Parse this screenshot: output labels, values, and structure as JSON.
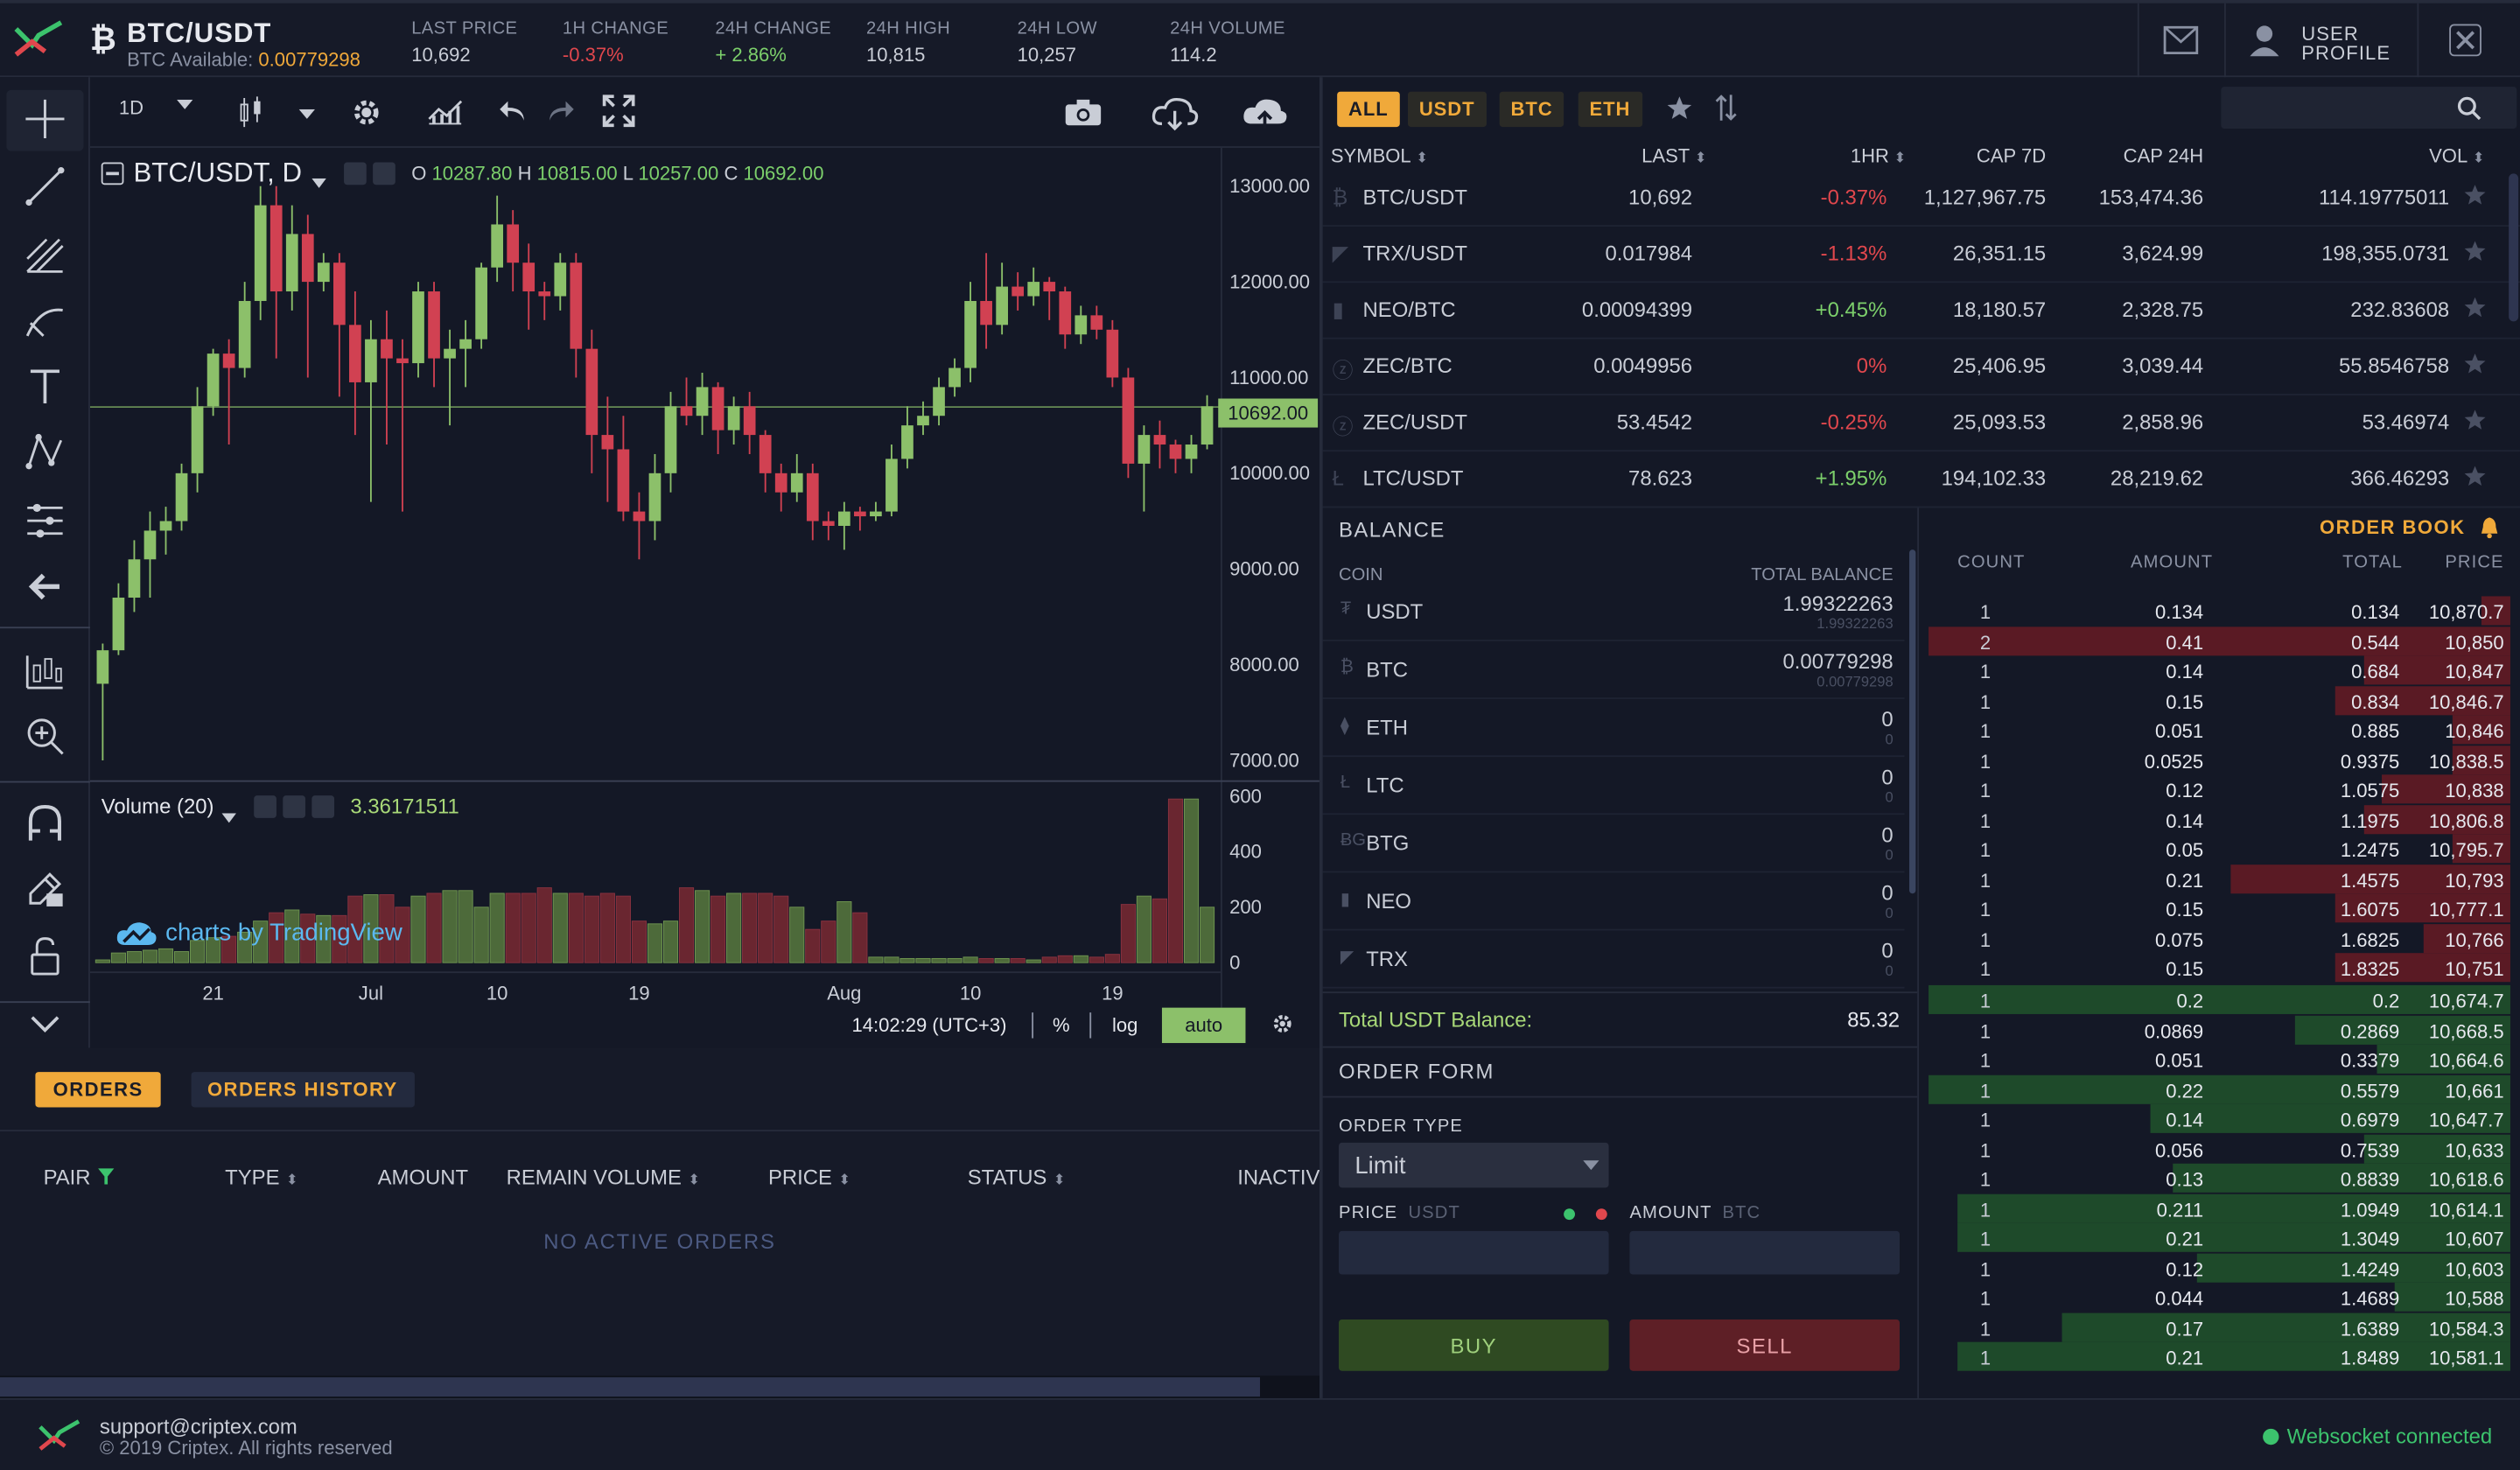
{
  "header": {
    "pair": "BTC/USDT",
    "available_label": "BTC Available:",
    "available_value": "0.00779298",
    "stats": [
      {
        "label": "LAST PRICE",
        "value": "10,692",
        "tone": "neutral"
      },
      {
        "label": "1H CHANGE",
        "value": "-0.37%",
        "tone": "red"
      },
      {
        "label": "24H CHANGE",
        "value": "+ 2.86%",
        "tone": "green"
      },
      {
        "label": "24H HIGH",
        "value": "10,815",
        "tone": "neutral"
      },
      {
        "label": "24H LOW",
        "value": "10,257",
        "tone": "neutral"
      },
      {
        "label": "24H VOLUME",
        "value": "114.2",
        "tone": "neutral"
      }
    ],
    "user_profile_line1": "USER",
    "user_profile_line2": "PROFILE"
  },
  "chart_toolbar": {
    "interval": "1D"
  },
  "chart_legend": {
    "title": "BTC/USDT, D",
    "o_label": "O",
    "o": "10287.80",
    "h_label": "H",
    "h": "10815.00",
    "l_label": "L",
    "l": "10257.00",
    "c_label": "C",
    "c": "10692.00",
    "volume_label": "Volume (20)",
    "volume_value": "3.36171511",
    "price_tag": "10692.00",
    "attribution": "charts by TradingView",
    "time": "14:02:29 (UTC+3)",
    "pct": "%",
    "log": "log",
    "auto": "auto"
  },
  "chart_data": {
    "type": "candlestick",
    "title": "BTC/USDT, D",
    "y_ticks": [
      "13000.00",
      "12000.00",
      "11000.00",
      "10000.00",
      "9000.00",
      "8000.00",
      "7000.00"
    ],
    "vol_ticks": [
      "600",
      "400",
      "200",
      "0"
    ],
    "x_ticks": [
      "21",
      "Jul",
      "10",
      "19",
      "Aug",
      "10",
      "19"
    ],
    "ylim": [
      6800,
      13400
    ],
    "vol_ylim": [
      0,
      620
    ],
    "last_price": 10692,
    "up_color": "#8cc06a",
    "down_color": "#d14152",
    "candles": [
      [
        7800,
        8150,
        7000,
        8220
      ],
      [
        8150,
        8700,
        8100,
        8850
      ],
      [
        8700,
        9100,
        8550,
        9300
      ],
      [
        9100,
        9400,
        8700,
        9600
      ],
      [
        9400,
        9500,
        9150,
        9650
      ],
      [
        9500,
        10000,
        9400,
        10100
      ],
      [
        10000,
        10700,
        9800,
        10900
      ],
      [
        10700,
        11250,
        10600,
        11300
      ],
      [
        11250,
        11100,
        10300,
        11400
      ],
      [
        11100,
        11800,
        11000,
        12000
      ],
      [
        11800,
        12800,
        11600,
        13000
      ],
      [
        12800,
        11900,
        11200,
        13000
      ],
      [
        11900,
        12500,
        11700,
        12800
      ],
      [
        12500,
        12000,
        11000,
        12700
      ],
      [
        12000,
        12200,
        11900,
        12300
      ],
      [
        12200,
        11550,
        10800,
        12300
      ],
      [
        11550,
        10950,
        10400,
        11900
      ],
      [
        10950,
        11400,
        9700,
        11600
      ],
      [
        11400,
        11200,
        10300,
        11700
      ],
      [
        11200,
        11150,
        9600,
        11400
      ],
      [
        11150,
        11900,
        11000,
        12000
      ],
      [
        11900,
        11200,
        10900,
        12000
      ],
      [
        11200,
        11300,
        10500,
        11500
      ],
      [
        11300,
        11400,
        10900,
        11600
      ],
      [
        11400,
        12150,
        11300,
        12200
      ],
      [
        12150,
        12600,
        12000,
        12900
      ],
      [
        12600,
        12200,
        11900,
        12750
      ],
      [
        12200,
        11900,
        11500,
        12400
      ],
      [
        11900,
        11850,
        11600,
        12000
      ],
      [
        11850,
        12200,
        11700,
        12300
      ],
      [
        12200,
        11300,
        11000,
        12300
      ],
      [
        11300,
        10400,
        10000,
        11500
      ],
      [
        10400,
        10250,
        9700,
        10800
      ],
      [
        10250,
        9600,
        9500,
        10600
      ],
      [
        9600,
        9500,
        9100,
        9800
      ],
      [
        9500,
        10000,
        9300,
        10200
      ],
      [
        10000,
        10700,
        9800,
        10850
      ],
      [
        10700,
        10600,
        10500,
        11000
      ],
      [
        10600,
        10900,
        10400,
        11050
      ],
      [
        10900,
        10450,
        10200,
        10950
      ],
      [
        10450,
        10700,
        10300,
        10800
      ],
      [
        10700,
        10400,
        10200,
        10850
      ],
      [
        10400,
        10000,
        9800,
        10450
      ],
      [
        10000,
        9800,
        9600,
        10100
      ],
      [
        9800,
        10000,
        9700,
        10200
      ],
      [
        10000,
        9500,
        9300,
        10100
      ],
      [
        9500,
        9450,
        9300,
        9600
      ],
      [
        9450,
        9600,
        9200,
        9700
      ],
      [
        9600,
        9550,
        9400,
        9650
      ],
      [
        9550,
        9600,
        9500,
        9700
      ],
      [
        9600,
        10150,
        9550,
        10300
      ],
      [
        10150,
        10500,
        10050,
        10700
      ],
      [
        10500,
        10600,
        10400,
        10750
      ],
      [
        10600,
        10900,
        10500,
        11000
      ],
      [
        10900,
        11100,
        10800,
        11200
      ],
      [
        11100,
        11800,
        10950,
        12000
      ],
      [
        11800,
        11550,
        11300,
        12300
      ],
      [
        11550,
        11950,
        11450,
        12200
      ],
      [
        11950,
        11850,
        11700,
        12100
      ],
      [
        11850,
        12000,
        11750,
        12150
      ],
      [
        12000,
        11900,
        11600,
        12050
      ],
      [
        11900,
        11450,
        11300,
        11950
      ],
      [
        11450,
        11650,
        11350,
        11750
      ],
      [
        11650,
        11500,
        11400,
        11750
      ],
      [
        11500,
        11000,
        10900,
        11600
      ],
      [
        11000,
        10100,
        9950,
        11100
      ],
      [
        10100,
        10400,
        9600,
        10500
      ],
      [
        10400,
        10300,
        10050,
        10550
      ],
      [
        10300,
        10150,
        10000,
        10350
      ],
      [
        10150,
        10300,
        10000,
        10400
      ],
      [
        10300,
        10700,
        10250,
        10815
      ]
    ],
    "volumes": [
      10,
      35,
      40,
      45,
      50,
      40,
      80,
      90,
      95,
      110,
      150,
      180,
      190,
      175,
      170,
      170,
      240,
      245,
      245,
      200,
      240,
      250,
      260,
      260,
      200,
      250,
      250,
      250,
      270,
      250,
      250,
      240,
      250,
      240,
      150,
      140,
      150,
      270,
      260,
      240,
      250,
      250,
      250,
      240,
      200,
      120,
      150,
      220,
      180,
      20,
      20,
      15,
      15,
      15,
      15,
      20,
      15,
      15,
      15,
      10,
      20,
      25,
      25,
      20,
      30,
      210,
      240,
      230,
      590,
      590,
      200
    ]
  },
  "left_toolbar": [
    "crosshair-icon",
    "trend-line-icon",
    "fib-icon",
    "brush-icon",
    "text-icon",
    "pattern-icon",
    "measure-icon",
    "back-arrow-icon",
    "long-position-icon",
    "zoom-in-icon",
    "magnet-icon",
    "lock-edit-icon",
    "unlock-icon",
    "chevron-down-icon"
  ],
  "market": {
    "filters": [
      "ALL",
      "USDT",
      "BTC",
      "ETH"
    ],
    "active_filter": "ALL",
    "columns": [
      "SYMBOL",
      "LAST",
      "1HR",
      "CAP 7D",
      "CAP 24H",
      "VOL"
    ],
    "rows": [
      {
        "symbol": "BTC/USDT",
        "last": "10,692",
        "hr": "-0.37%",
        "hr_tone": "red",
        "cap7": "1,127,967.75",
        "cap24": "153,474.36",
        "vol": "114.19775011"
      },
      {
        "symbol": "TRX/USDT",
        "last": "0.017984",
        "hr": "-1.13%",
        "hr_tone": "red",
        "cap7": "26,351.15",
        "cap24": "3,624.99",
        "vol": "198,355.0731"
      },
      {
        "symbol": "NEO/BTC",
        "last": "0.00094399",
        "hr": "+0.45%",
        "hr_tone": "green",
        "cap7": "18,180.57",
        "cap24": "2,328.75",
        "vol": "232.83608"
      },
      {
        "symbol": "ZEC/BTC",
        "last": "0.0049956",
        "hr": "0%",
        "hr_tone": "red",
        "cap7": "25,406.95",
        "cap24": "3,039.44",
        "vol": "55.8546758"
      },
      {
        "symbol": "ZEC/USDT",
        "last": "53.4542",
        "hr": "-0.25%",
        "hr_tone": "red",
        "cap7": "25,093.53",
        "cap24": "2,858.96",
        "vol": "53.46974"
      },
      {
        "symbol": "LTC/USDT",
        "last": "78.623",
        "hr": "+1.95%",
        "hr_tone": "green",
        "cap7": "194,102.33",
        "cap24": "28,219.62",
        "vol": "366.46293"
      }
    ]
  },
  "balance": {
    "title": "BALANCE",
    "col_coin": "COIN",
    "col_total": "TOTAL BALANCE",
    "rows": [
      {
        "coin": "USDT",
        "total": "1.99322263",
        "sub": "1.99322263"
      },
      {
        "coin": "BTC",
        "total": "0.00779298",
        "sub": "0.00779298"
      },
      {
        "coin": "ETH",
        "total": "0",
        "sub": "0"
      },
      {
        "coin": "LTC",
        "total": "0",
        "sub": "0"
      },
      {
        "coin": "BTG",
        "total": "0",
        "sub": "0"
      },
      {
        "coin": "NEO",
        "total": "0",
        "sub": "0"
      },
      {
        "coin": "TRX",
        "total": "0",
        "sub": "0"
      }
    ],
    "total_label": "Total USDT Balance:",
    "total_value": "85.32"
  },
  "order_form": {
    "title": "ORDER FORM",
    "type_label": "ORDER TYPE",
    "type_value": "Limit",
    "price_label": "PRICE",
    "price_unit": "USDT",
    "amount_label": "AMOUNT",
    "amount_unit": "BTC",
    "buy": "BUY",
    "sell": "SELL"
  },
  "order_book": {
    "title": "ORDER BOOK",
    "columns": [
      "COUNT",
      "AMOUNT",
      "TOTAL",
      "PRICE"
    ],
    "asks": [
      {
        "count": "1",
        "amount": "0.134",
        "total": "0.134",
        "price": "10,870.7",
        "depth": 0.05
      },
      {
        "count": "2",
        "amount": "0.41",
        "total": "0.544",
        "price": "10,850",
        "depth": 1.0
      },
      {
        "count": "1",
        "amount": "0.14",
        "total": "0.684",
        "price": "10,847",
        "depth": 0.25
      },
      {
        "count": "1",
        "amount": "0.15",
        "total": "0.834",
        "price": "10,846.7",
        "depth": 0.3
      },
      {
        "count": "1",
        "amount": "0.051",
        "total": "0.885",
        "price": "10,846",
        "depth": 0.1
      },
      {
        "count": "1",
        "amount": "0.0525",
        "total": "0.9375",
        "price": "10,838.5",
        "depth": 0.1
      },
      {
        "count": "1",
        "amount": "0.12",
        "total": "1.0575",
        "price": "10,838",
        "depth": 0.22
      },
      {
        "count": "1",
        "amount": "0.14",
        "total": "1.1975",
        "price": "10,806.8",
        "depth": 0.25
      },
      {
        "count": "1",
        "amount": "0.05",
        "total": "1.2475",
        "price": "10,795.7",
        "depth": 0.1
      },
      {
        "count": "1",
        "amount": "0.21",
        "total": "1.4575",
        "price": "10,793",
        "depth": 0.48
      },
      {
        "count": "1",
        "amount": "0.15",
        "total": "1.6075",
        "price": "10,777.1",
        "depth": 0.3
      },
      {
        "count": "1",
        "amount": "0.075",
        "total": "1.6825",
        "price": "10,766",
        "depth": 0.15
      },
      {
        "count": "1",
        "amount": "0.15",
        "total": "1.8325",
        "price": "10,751",
        "depth": 0.3
      }
    ],
    "bids": [
      {
        "count": "1",
        "amount": "0.2",
        "total": "0.2",
        "price": "10,674.7",
        "depth": 1.0
      },
      {
        "count": "1",
        "amount": "0.0869",
        "total": "0.2869",
        "price": "10,668.5",
        "depth": 0.37
      },
      {
        "count": "1",
        "amount": "0.051",
        "total": "0.3379",
        "price": "10,664.6",
        "depth": 0.23
      },
      {
        "count": "1",
        "amount": "0.22",
        "total": "0.5579",
        "price": "10,661",
        "depth": 1.0
      },
      {
        "count": "1",
        "amount": "0.14",
        "total": "0.6979",
        "price": "10,647.7",
        "depth": 0.62
      },
      {
        "count": "1",
        "amount": "0.056",
        "total": "0.7539",
        "price": "10,633",
        "depth": 0.25
      },
      {
        "count": "1",
        "amount": "0.13",
        "total": "0.8839",
        "price": "10,618.6",
        "depth": 0.58
      },
      {
        "count": "1",
        "amount": "0.211",
        "total": "1.0949",
        "price": "10,614.1",
        "depth": 0.95
      },
      {
        "count": "1",
        "amount": "0.21",
        "total": "1.3049",
        "price": "10,607",
        "depth": 0.95
      },
      {
        "count": "1",
        "amount": "0.12",
        "total": "1.4249",
        "price": "10,603",
        "depth": 0.54
      },
      {
        "count": "1",
        "amount": "0.044",
        "total": "1.4689",
        "price": "10,588",
        "depth": 0.2
      },
      {
        "count": "1",
        "amount": "0.17",
        "total": "1.6389",
        "price": "10,584.3",
        "depth": 0.77
      },
      {
        "count": "1",
        "amount": "0.21",
        "total": "1.8489",
        "price": "10,581.1",
        "depth": 0.95
      }
    ]
  },
  "orders": {
    "tabs": [
      "ORDERS",
      "ORDERS HISTORY"
    ],
    "columns": [
      "PAIR",
      "TYPE",
      "AMOUNT",
      "REMAIN VOLUME",
      "PRICE",
      "STATUS",
      "INACTIVE"
    ],
    "empty": "NO ACTIVE ORDERS"
  },
  "footer": {
    "email": "support@criptex.com",
    "copyright": "© 2019 Criptex. All rights reserved",
    "status": "Websocket connected"
  },
  "colors": {
    "accent": "#f0a93a",
    "green": "#7ccf6b",
    "red": "#e0474d",
    "bg": "#141826"
  }
}
